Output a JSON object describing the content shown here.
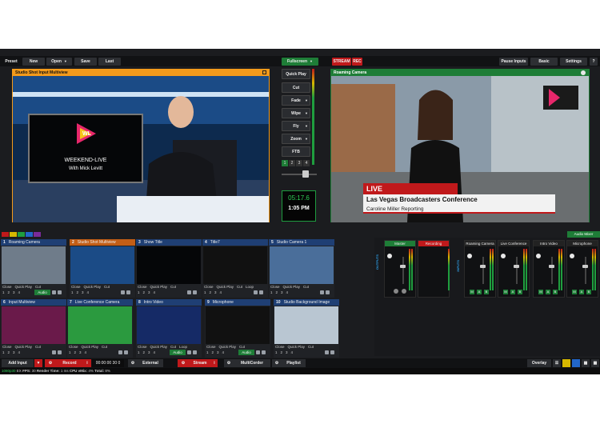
{
  "topbar": {
    "preset": "Preset",
    "new": "New",
    "open": "Open",
    "save": "Save",
    "last": "Last",
    "fullscreen": "Fullscreen",
    "stream": "STREAM",
    "rec": "REC",
    "pause_inputs": "Pause Inputs",
    "basic": "Basic",
    "settings": "Settings",
    "help": "?"
  },
  "preview": {
    "title": "Studio Shot Input Multiview",
    "logo_text": "WL",
    "show_name": "WEEKEND-LIVE",
    "host_line": "With Mick Levitt"
  },
  "output": {
    "title": "Roaming Camera",
    "live_label": "LIVE",
    "headline": "Las Vegas Broadcasters Conference",
    "byline": "Caroline Miller Reporting"
  },
  "transitions": {
    "quick_play": "Quick Play",
    "cut": "Cut",
    "fade": "Fade",
    "wipe": "Wipe",
    "fly": "Fly",
    "zoom": "Zoom",
    "ftb": "FTB",
    "pages": [
      "1",
      "2",
      "3",
      "4"
    ],
    "timecode": "05:17.6",
    "clock": "1:05 PM"
  },
  "inputs": [
    {
      "num": "1",
      "name": "Roaming Camera",
      "controls": [
        "Close",
        "Quick Play",
        "Cut"
      ],
      "audio": "Audio"
    },
    {
      "num": "2",
      "name": "Studio Shot Multiview",
      "controls": [
        "Close",
        "Quick Play",
        "Cut"
      ],
      "audio": ""
    },
    {
      "num": "3",
      "name": "Show Title",
      "controls": [
        "Close",
        "Quick Play",
        "Cut"
      ],
      "audio": ""
    },
    {
      "num": "4",
      "name": "Title7",
      "controls": [
        "Close",
        "Quick Play",
        "Cut",
        "Loop"
      ],
      "audio": ""
    },
    {
      "num": "5",
      "name": "Studio Camera 1",
      "controls": [
        "Close",
        "Quick Play",
        "Cut"
      ],
      "audio": ""
    },
    {
      "num": "6",
      "name": "Input Multiview",
      "controls": [
        "Close",
        "Quick Play",
        "Cut"
      ],
      "audio": ""
    },
    {
      "num": "7",
      "name": "Live Conference Camera",
      "controls": [
        "Close",
        "Quick Play",
        "Cut"
      ],
      "audio": ""
    },
    {
      "num": "8",
      "name": "Intro Video",
      "controls": [
        "Close",
        "Quick Play",
        "Cut",
        "Loop"
      ],
      "audio": "Audio"
    },
    {
      "num": "9",
      "name": "Microphone",
      "controls": [
        "Close",
        "Quick Play",
        "Cut"
      ],
      "audio": "Audio"
    },
    {
      "num": "10",
      "name": "Studio Background Image",
      "controls": [
        "Close",
        "Quick Play",
        "Cut"
      ],
      "audio": ""
    }
  ],
  "tile_numbers": [
    "1",
    "2",
    "3",
    "4"
  ],
  "mixer": {
    "header": "Audio Mixer",
    "outputs_label": "OUTPUTS",
    "inputs_label": "INPUTS",
    "master": "Master",
    "recording": "Recording",
    "channels": [
      "Roaming Camera",
      "Live Conference",
      "Intro Video",
      "Microphone"
    ],
    "mab": [
      "M",
      "A",
      "B"
    ]
  },
  "bottombar": {
    "add_input": "Add Input",
    "record": "Record",
    "record_time": "00:00:00 30 0",
    "external": "External",
    "stream": "Stream",
    "multicorder": "MultiCorder",
    "playlist": "Playlist",
    "overlay": "Overlay"
  },
  "status": {
    "res": "1080p30",
    "ex": "EX",
    "fps_label": "FPS:",
    "fps": "30",
    "render_label": "Render Time:",
    "render": "1 ms",
    "cpu_label": "CPU vMix:",
    "cpu": "4%",
    "total_label": "Total:",
    "total": "8%"
  },
  "colors": {
    "accent_green": "#1e7d37",
    "accent_red": "#c0191b",
    "preview_orange": "#f39a1b",
    "program_green": "#1e7d37",
    "tile_blue": "#1f3f74"
  }
}
